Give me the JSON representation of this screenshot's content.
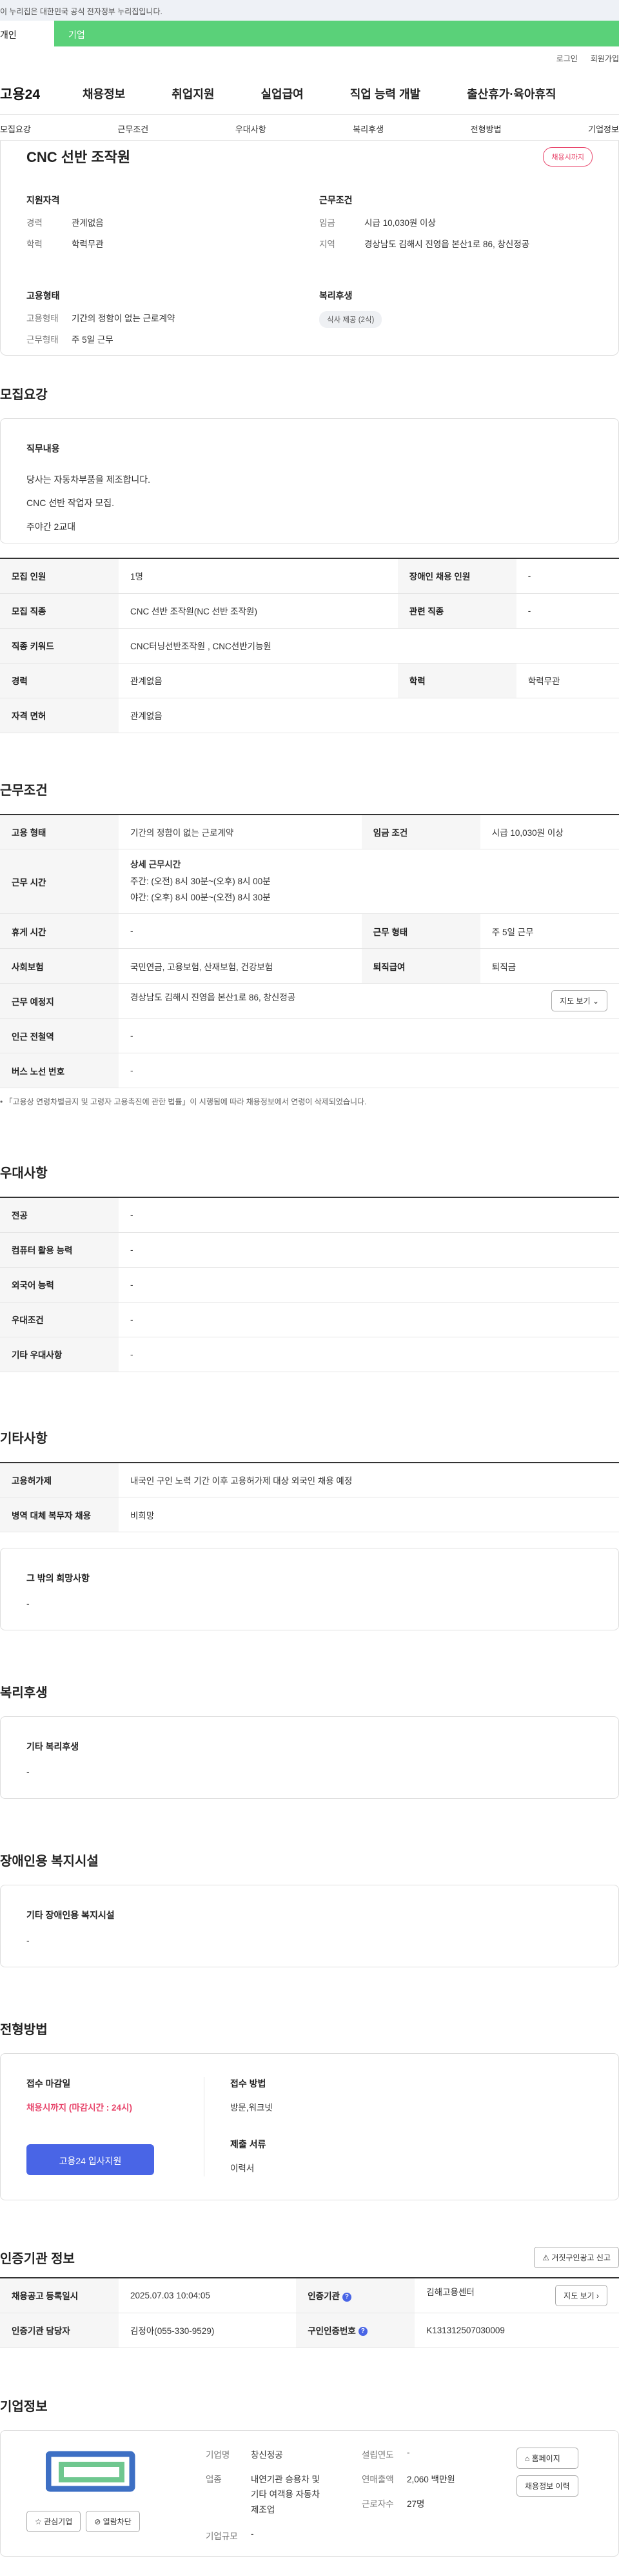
{
  "gov_banner": "이 누리집은 대한민국 공식 전자정부 누리집입니다.",
  "top_tabs": [
    "개인",
    "기업"
  ],
  "util": [
    "로그인",
    "회원가입"
  ],
  "logo": "고용24",
  "gnb": [
    "채용정보",
    "취업지원",
    "실업급여",
    "직업 능력 개발",
    "출산휴가·육아휴직"
  ],
  "subnav": [
    "모집요강",
    "근무조건",
    "우대사항",
    "복리후생",
    "전형방법",
    "기업정보"
  ],
  "summary": {
    "title": "CNC 선반 조작원",
    "status": "채용시까지",
    "qual_title": "지원자격",
    "qual": [
      {
        "k": "경력",
        "v": "관계없음"
      },
      {
        "k": "학력",
        "v": "학력무관"
      }
    ],
    "cond_title": "근무조건",
    "cond": [
      {
        "k": "임금",
        "v": "시급 10,030원 이상"
      },
      {
        "k": "지역",
        "v": "경상남도 김해시 진영읍 본산1로 86, 창신정공"
      }
    ],
    "form_title": "고용형태",
    "form": [
      {
        "k": "고용형태",
        "v": "기간의 정함이 없는 근로계약"
      },
      {
        "k": "근무형태",
        "v": "주 5일 근무"
      }
    ],
    "welfare_title": "복리후생",
    "welfare_chip": "식사 제공 (2식)"
  },
  "recruit": {
    "title": "모집요강",
    "duty_title": "직무내용",
    "duty_lines": [
      "당사는 자동차부품을 제조합니다.",
      "CNC 선반 작업자 모집.",
      "주야간 2교대"
    ],
    "rows": [
      {
        "h1": "모집 인원",
        "v1": "1명",
        "h2": "장애인 채용 인원",
        "v2": "-"
      },
      {
        "h1": "모집 직종",
        "v1": "CNC 선반 조작원(NC 선반 조작원)",
        "h2": "관련 직종",
        "v2": "-"
      },
      {
        "h1": "직종 키워드",
        "v1": "CNC터닝선반조작원 , CNC선반기능원"
      },
      {
        "h1": "경력",
        "v1": "관계없음",
        "h2": "학력",
        "v2": "학력무관"
      },
      {
        "h1": "자격 면허",
        "v1": "관계없음"
      }
    ]
  },
  "work": {
    "title": "근무조건",
    "emp_type_h": "고용 형태",
    "emp_type": "기간의 정함이 없는 근로계약",
    "wage_h": "임금 조건",
    "wage": "시급 10,030원 이상",
    "hours_h": "근무 시간",
    "hours_title": "상세 근무시간",
    "hours_lines": [
      "주간: (오전) 8시 30분~(오후) 8시 00분",
      "야간: (오후) 8시 00분~(오전) 8시 30분"
    ],
    "rest_h": "휴게 시간",
    "rest": "-",
    "shift_h": "근무 형태",
    "shift": "주 5일 근무",
    "ins_h": "사회보험",
    "ins": "국민연금, 고용보험, 산재보험, 건강보험",
    "sev_h": "퇴직급여",
    "sev": "퇴직금",
    "place_h": "근무 예정지",
    "place": "경상남도 김해시 진영읍 본산1로 86, 창신정공",
    "map_btn": "지도 보기",
    "subway_h": "인근 전철역",
    "subway": "-",
    "bus_h": "버스 노선 번호",
    "bus": "-",
    "note": "「고용상 연령차별금지 및 고령자 고용촉진에 관한 법률」이 시행됨에 따라 채용정보에서 연령이 삭제되었습니다."
  },
  "pref": {
    "title": "우대사항",
    "rows": [
      {
        "h": "전공",
        "v": "-"
      },
      {
        "h": "컴퓨터 활용 능력",
        "v": "-"
      },
      {
        "h": "외국어 능력",
        "v": "-"
      },
      {
        "h": "우대조건",
        "v": "-"
      },
      {
        "h": "기타 우대사항",
        "v": "-"
      }
    ]
  },
  "etc": {
    "title": "기타사항",
    "rows": [
      {
        "h": "고용허가제",
        "v": "내국인 구인 노력 기간 이후 고용허가제 대상 외국인 채용 예정"
      },
      {
        "h": "병역 대체 복무자 채용",
        "v": "비희망"
      }
    ],
    "other_title": "그 밖의 희망사항",
    "other": "-"
  },
  "welfare": {
    "title": "복리후생",
    "box_title": "기타 복리후생",
    "box_val": "-"
  },
  "disab": {
    "title": "장애인용 복지시설",
    "box_title": "기타 장애인용 복지시설",
    "box_val": "-"
  },
  "select": {
    "title": "전형방법",
    "deadline_h": "접수 마감일",
    "deadline": "채용시까지 (마감시간 : 24시)",
    "method_h": "접수 방법",
    "method": "방문,워크넷",
    "docs_h": "제출 서류",
    "docs": "이력서",
    "apply_btn": "고용24 입사지원"
  },
  "cert": {
    "title": "인증기관 정보",
    "report_btn": "거짓구인광고 신고",
    "reg_h": "채용공고 등록일시",
    "reg": "2025.07.03 10:04:05",
    "org_h": "인증기관",
    "org": "김해고용센터",
    "map_btn": "지도 보기",
    "mgr_h": "인증기관 담당자",
    "mgr": "김정아(055-330-9529)",
    "no_h": "구인인증번호",
    "no": "K131312507030009"
  },
  "company": {
    "title": "기업정보",
    "name_h": "기업명",
    "name": "창신정공",
    "year_h": "설립연도",
    "year": "-",
    "ind_h": "업종",
    "ind": "내연기관 승용차 및 기타 여객용 자동차 제조업",
    "sales_h": "연매출액",
    "sales": "2,060 백만원",
    "emp_h": "근로자수",
    "emp": "27명",
    "size_h": "기업규모",
    "size": "-",
    "fav_btn": "관심기업",
    "block_btn": "열람차단",
    "home_btn": "홈페이지",
    "list_btn": "채용정보 이력",
    "logo_color": "#3d6fc4",
    "logo_color2": "#6fc78f"
  }
}
